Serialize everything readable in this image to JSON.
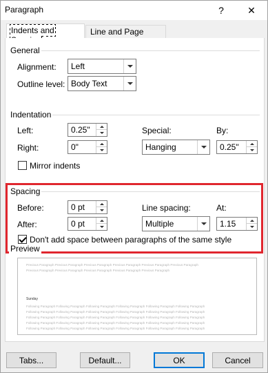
{
  "window": {
    "title": "Paragraph",
    "help_icon": "?",
    "close_icon": "✕"
  },
  "tabs": [
    {
      "label": "Indents and Spacing",
      "active": true
    },
    {
      "label": "Line and Page Breaks",
      "active": false
    }
  ],
  "general": {
    "label": "General",
    "alignment_label": "Alignment:",
    "alignment_value": "Left",
    "outline_label": "Outline level:",
    "outline_value": "Body Text"
  },
  "indentation": {
    "label": "Indentation",
    "left_label": "Left:",
    "left_value": "0.25\"",
    "right_label": "Right:",
    "right_value": "0\"",
    "special_label": "Special:",
    "special_value": "Hanging",
    "by_label": "By:",
    "by_value": "0.25\"",
    "mirror_label": "Mirror indents",
    "mirror_checked": false
  },
  "spacing": {
    "label": "Spacing",
    "before_label": "Before:",
    "before_value": "0 pt",
    "after_label": "After:",
    "after_value": "0 pt",
    "line_spacing_label": "Line spacing:",
    "line_spacing_value": "Multiple",
    "at_label": "At:",
    "at_value": "1.15",
    "dont_add_label": "Don't add space between paragraphs of the same style",
    "dont_add_checked": true,
    "highlight_color": "#e0262e"
  },
  "preview": {
    "label": "Preview",
    "previous_lines": [
      "Previous Paragraph Previous Paragraph Previous Paragraph Previous Paragraph Previous Paragraph Previous Paragraph",
      "Previous Paragraph Previous Paragraph Previous Paragraph Previous Paragraph Previous Paragraph"
    ],
    "sample_text": "Sunday",
    "following_lines": [
      "Following Paragraph Following Paragraph Following Paragraph Following Paragraph Following Paragraph Following Paragraph",
      "Following Paragraph Following Paragraph Following Paragraph Following Paragraph Following Paragraph Following Paragraph",
      "Following Paragraph Following Paragraph Following Paragraph Following Paragraph Following Paragraph Following Paragraph",
      "Following Paragraph Following Paragraph Following Paragraph Following Paragraph Following Paragraph Following Paragraph",
      "Following Paragraph Following Paragraph Following Paragraph Following Paragraph Following Paragraph Following Paragraph"
    ]
  },
  "buttons": {
    "tabs": "Tabs...",
    "default": "Default...",
    "ok": "OK",
    "cancel": "Cancel"
  }
}
